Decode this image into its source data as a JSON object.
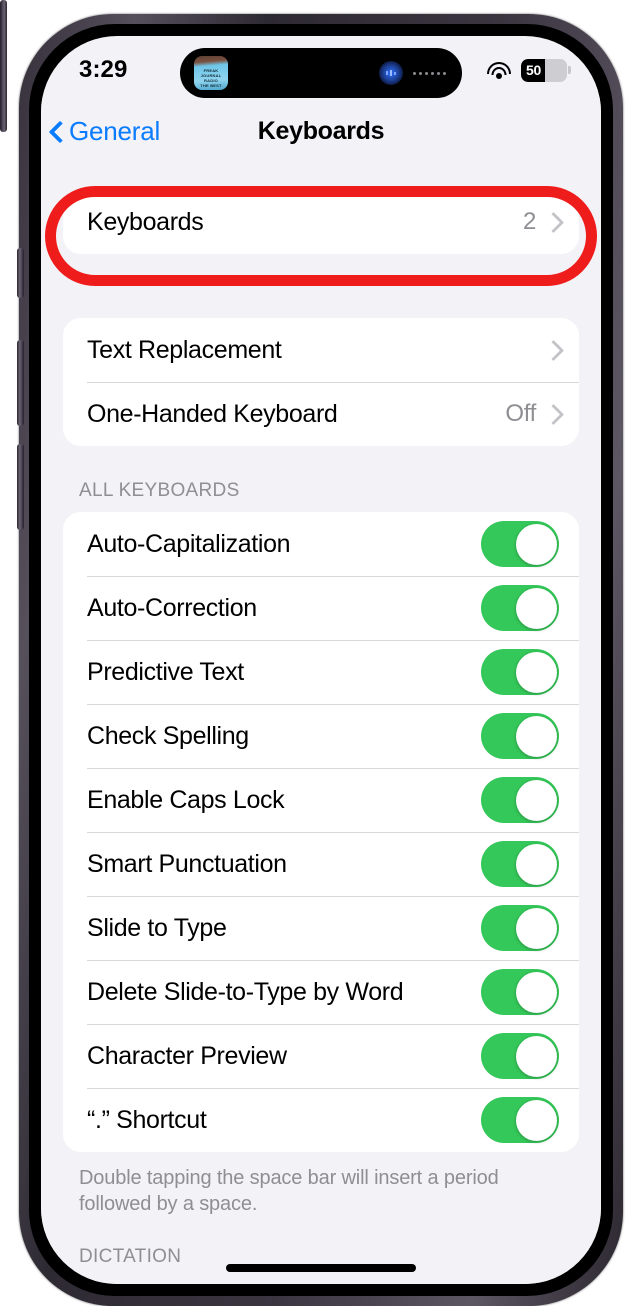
{
  "status_bar": {
    "time": "3:29",
    "wifi_icon": "wifi-icon",
    "battery_percent": "50",
    "battery_level": 52
  },
  "dynamic_island": {
    "artwork_lines": [
      "FREAK",
      "JOURNAL",
      "RADIO",
      "THE BEST"
    ],
    "orb_icon": "siri-orb-icon",
    "dots_icon": "audio-waveform-dots-icon"
  },
  "nav": {
    "back_label": "General",
    "title": "Keyboards"
  },
  "highlight": {
    "color": "#ef1c1c",
    "target": "keyboards-row"
  },
  "groups": [
    {
      "name": "keyboards-group",
      "rows": [
        {
          "label": "Keyboards",
          "value": "2",
          "type": "disclosure"
        }
      ]
    },
    {
      "name": "text-group",
      "rows": [
        {
          "label": "Text Replacement",
          "value": "",
          "type": "disclosure"
        },
        {
          "label": "One-Handed Keyboard",
          "value": "Off",
          "type": "disclosure"
        }
      ]
    }
  ],
  "all_keyboards": {
    "header": "ALL KEYBOARDS",
    "footer": "Double tapping the space bar will insert a period followed by a space.",
    "rows": [
      {
        "label": "Auto-Capitalization",
        "state": "on"
      },
      {
        "label": "Auto-Correction",
        "state": "on"
      },
      {
        "label": "Predictive Text",
        "state": "on"
      },
      {
        "label": "Check Spelling",
        "state": "on"
      },
      {
        "label": "Enable Caps Lock",
        "state": "on"
      },
      {
        "label": "Smart Punctuation",
        "state": "on"
      },
      {
        "label": "Slide to Type",
        "state": "on"
      },
      {
        "label": "Delete Slide-to-Type by Word",
        "state": "on"
      },
      {
        "label": "Character Preview",
        "state": "on"
      },
      {
        "label": "“.” Shortcut",
        "state": "on"
      }
    ]
  },
  "next_section": {
    "header": "DICTATION"
  },
  "colors": {
    "accent_blue": "#0a7cff",
    "toggle_green": "#34c759",
    "page_background": "#f2f2f7",
    "card_background": "#ffffff",
    "secondary_text": "#8e8e93",
    "highlight_red": "#ef1c1c"
  }
}
